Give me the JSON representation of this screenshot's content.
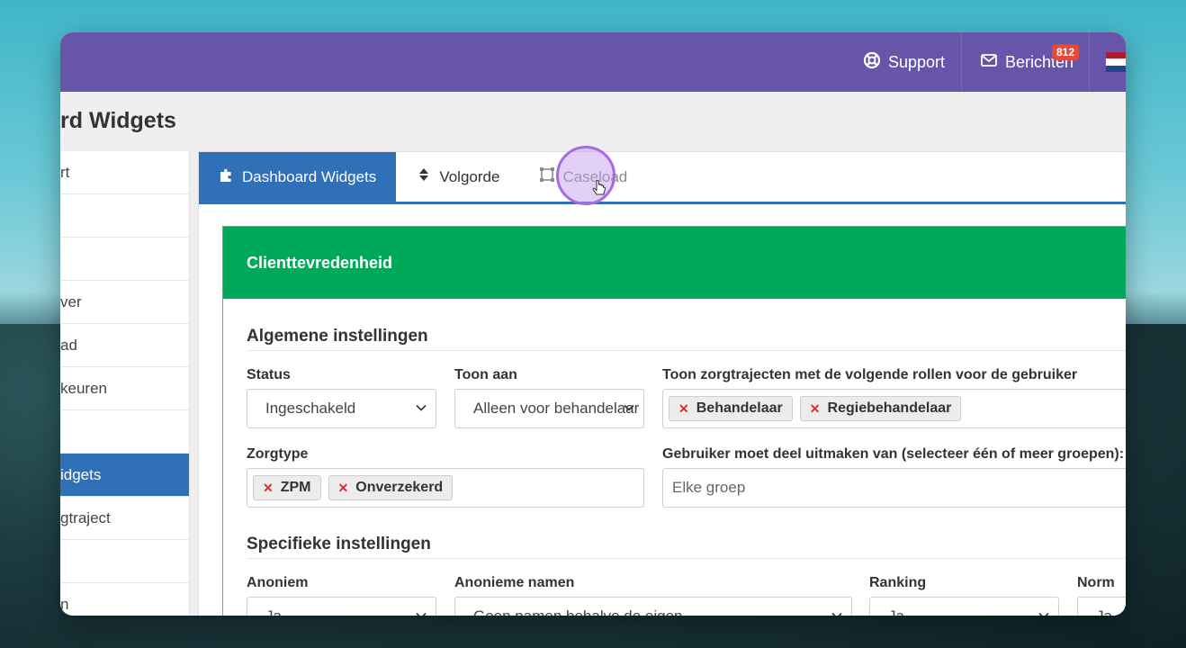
{
  "topbar": {
    "support_label": "Support",
    "messages_label": "Berichten",
    "messages_badge": "812"
  },
  "page": {
    "title": "rd Widgets"
  },
  "sidebar": {
    "items": [
      {
        "label": "rt"
      },
      {
        "label": ""
      },
      {
        "label": ""
      },
      {
        "label": "ver"
      },
      {
        "label": "ad"
      },
      {
        "label": "keuren"
      },
      {
        "label": ""
      },
      {
        "label": "idgets",
        "active": true
      },
      {
        "label": "gtraject"
      },
      {
        "label": ""
      },
      {
        "label": "n"
      }
    ]
  },
  "tabs": {
    "dashboard_widgets": "Dashboard Widgets",
    "volgorde": "Volgorde",
    "caseload": "Caseload"
  },
  "card": {
    "header": "Clienttevredenheid",
    "general_title": "Algemene instellingen",
    "status_label": "Status",
    "status_value": "Ingeschakeld",
    "toon_aan_label": "Toon aan",
    "toon_aan_value": "Alleen voor behandelaar",
    "rollen_label": "Toon zorgtrajecten met de volgende rollen voor de gebruiker",
    "rollen_tags": [
      "Behandelaar",
      "Regiebehandelaar"
    ],
    "zorgtype_label": "Zorgtype",
    "zorgtype_tags": [
      "ZPM",
      "Onverzekerd"
    ],
    "groepen_label": "Gebruiker moet deel uitmaken van (selecteer één of meer groepen):",
    "groepen_placeholder": "Elke groep",
    "specific_title": "Specifieke instellingen",
    "anoniem_label": "Anoniem",
    "anoniem_value": "Ja",
    "anonieme_namen_label": "Anonieme namen",
    "anonieme_namen_value": "Geen namen behalve de eigen",
    "ranking_label": "Ranking",
    "ranking_value": "Ja",
    "norm_label": "Norm",
    "norm_value": "Ja"
  },
  "colors": {
    "topbar": "#6655a8",
    "primary": "#2f70b7",
    "card_header": "#00a859",
    "tag_remove": "#d0312d",
    "badge": "#e24b3b"
  }
}
